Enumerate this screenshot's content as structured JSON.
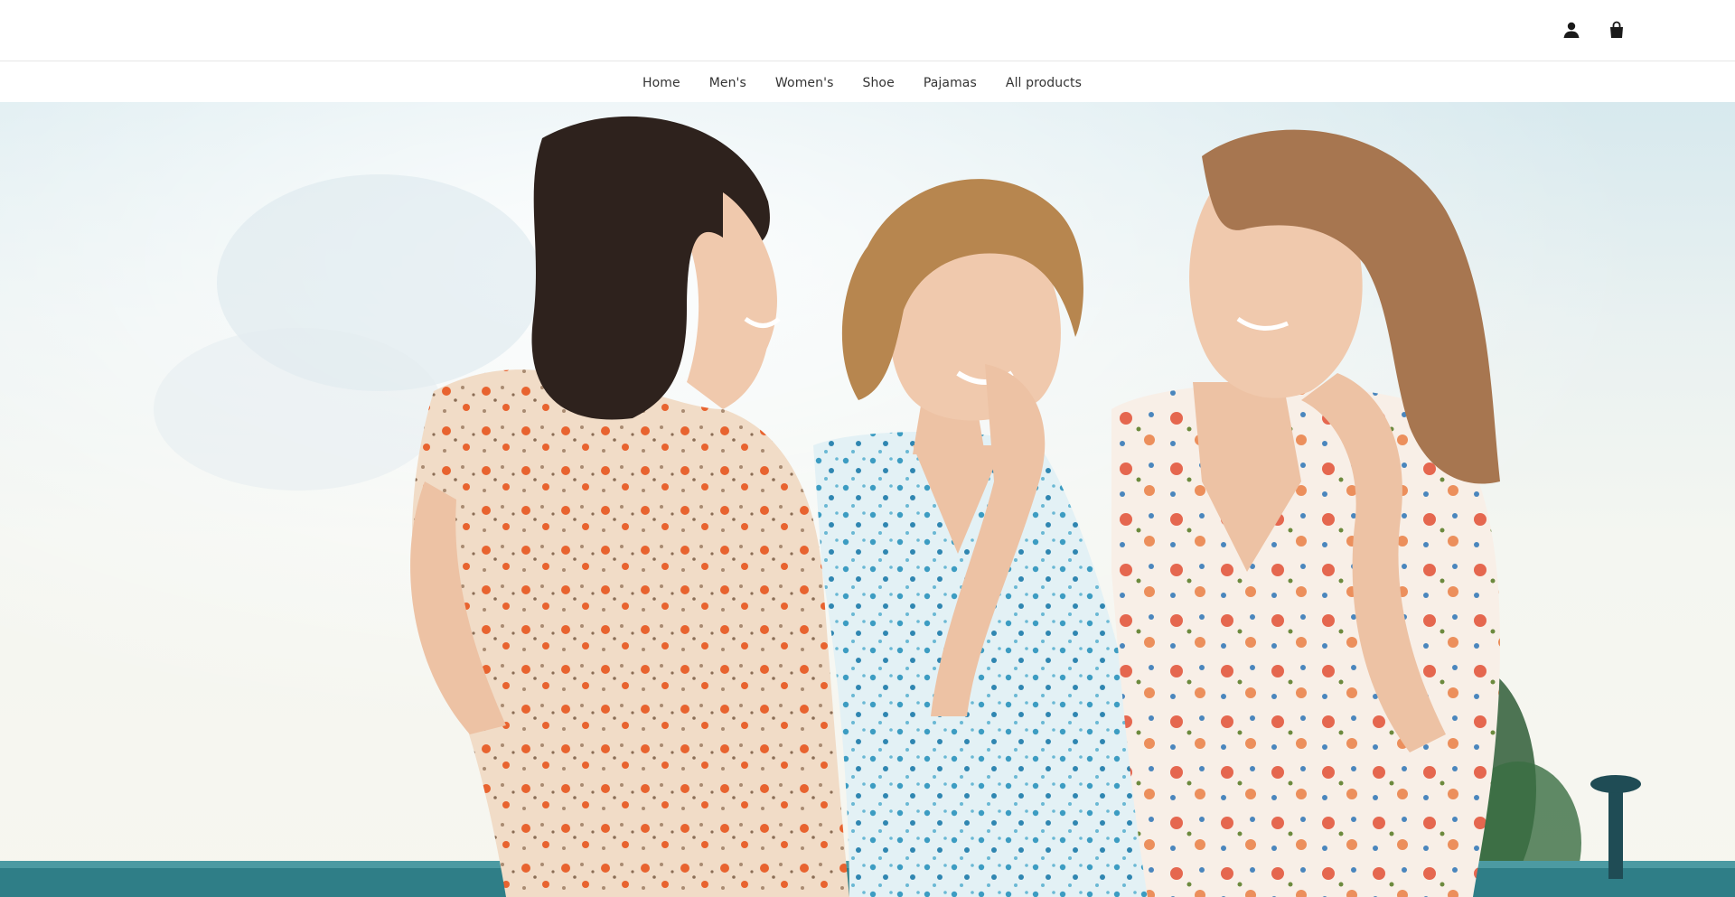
{
  "header": {
    "account_icon": "user-icon",
    "cart_icon": "shopping-bag-icon"
  },
  "nav": {
    "items": [
      {
        "label": "Home"
      },
      {
        "label": "Men's"
      },
      {
        "label": "Women's"
      },
      {
        "label": "Shoe"
      },
      {
        "label": "Pajamas"
      },
      {
        "label": "All products"
      }
    ]
  },
  "hero": {
    "image": "hero-photo-three-women-in-floral-dresses",
    "colors": {
      "sky": "#e4eff1",
      "skin": "#f0c9ad",
      "hair_dark": "#3b2a22",
      "hair_blonde": "#b7864f",
      "hair_light_brown": "#a77650",
      "dress_peach": "#f1dcc7",
      "dress_blue": "#d9ecf2",
      "dress_white": "#f7eee6",
      "railing": "#2f7e87"
    }
  }
}
